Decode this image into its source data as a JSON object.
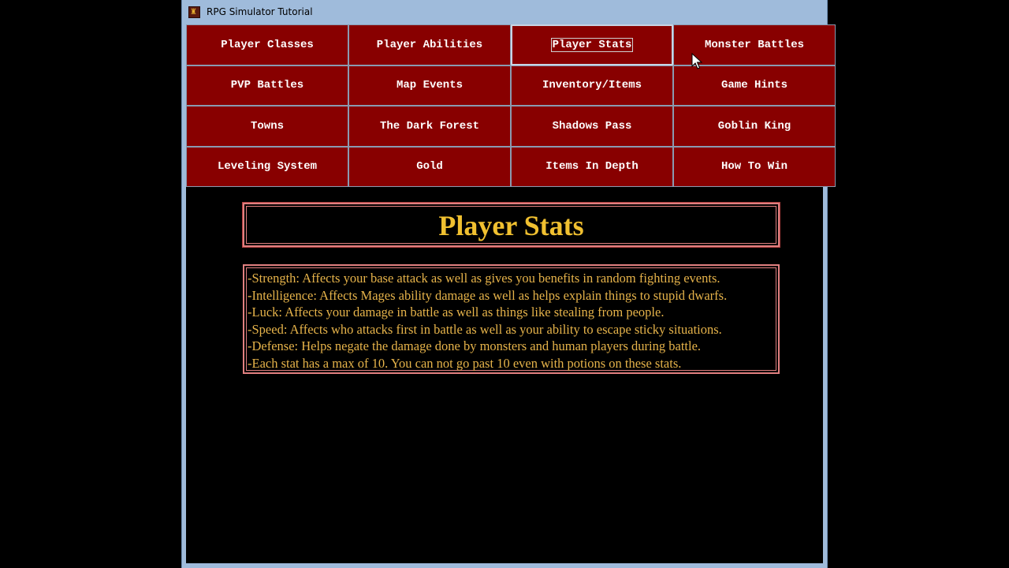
{
  "window": {
    "title": "RPG Simulator Tutorial",
    "icon": "app-icon",
    "titlebar_color": "#9fbbdb"
  },
  "nav": {
    "button_color": "#880000",
    "buttons": [
      {
        "label": "Player Classes",
        "active": false
      },
      {
        "label": "Player Abilities",
        "active": false
      },
      {
        "label": "Player Stats",
        "active": true
      },
      {
        "label": "Monster Battles",
        "active": false
      },
      {
        "label": "PVP Battles",
        "active": false
      },
      {
        "label": "Map Events",
        "active": false
      },
      {
        "label": "Inventory/Items",
        "active": false
      },
      {
        "label": "Game Hints",
        "active": false
      },
      {
        "label": "Towns",
        "active": false
      },
      {
        "label": "The Dark Forest",
        "active": false
      },
      {
        "label": "Shadows Pass",
        "active": false
      },
      {
        "label": "Goblin King",
        "active": false
      },
      {
        "label": "Leveling System",
        "active": false
      },
      {
        "label": "Gold",
        "active": false
      },
      {
        "label": "Items In Depth",
        "active": false
      },
      {
        "label": "How To Win",
        "active": false
      }
    ]
  },
  "page": {
    "title": "Player Stats",
    "title_color": "#f0c030",
    "text_color": "#e6b34a",
    "border_color": "#e08080",
    "lines": [
      "-Strength: Affects your base attack as well as gives you benefits in random fighting events.",
      "-Intelligence: Affects Mages ability damage as well as helps explain things to stupid dwarfs.",
      "-Luck: Affects your damage in battle as well as things like stealing from people.",
      "-Speed: Affects who attacks first in battle as well as your ability to escape sticky situations.",
      "-Defense: Helps negate the damage done by monsters and human players during battle.",
      "-Each stat has a max of 10. You can not go past 10 even with potions on these stats."
    ]
  }
}
